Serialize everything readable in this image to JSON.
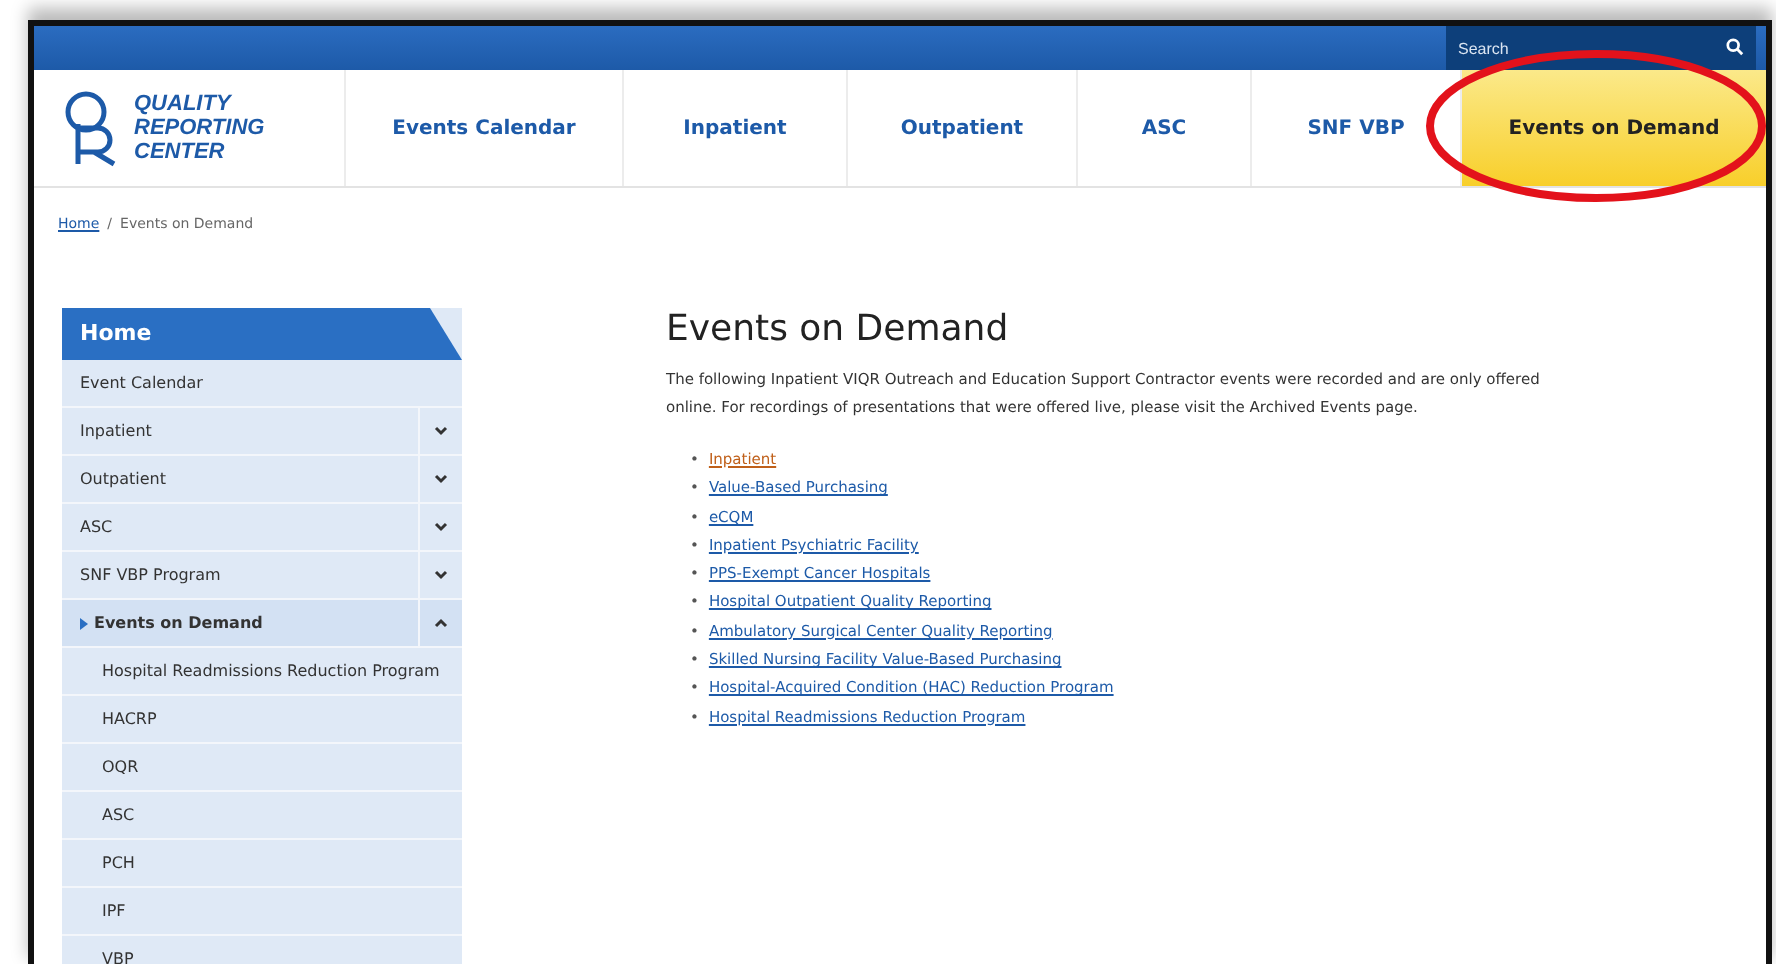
{
  "top_bar": {
    "search": {
      "placeholder": "Search"
    }
  },
  "logo": {
    "lines": [
      "QUALITY",
      "REPORTING",
      "CENTER"
    ]
  },
  "nav": [
    {
      "label": "Events Calendar",
      "selected": false,
      "circled": false
    },
    {
      "label": "Inpatient",
      "selected": false,
      "circled": false
    },
    {
      "label": "Outpatient",
      "selected": false,
      "circled": false
    },
    {
      "label": "ASC",
      "selected": false,
      "circled": false
    },
    {
      "label": "SNF VBP",
      "selected": false,
      "circled": false
    },
    {
      "label": "Events on Demand",
      "selected": true,
      "circled": true
    }
  ],
  "breadcrumb": {
    "link": "Home",
    "separator": "/",
    "current": "Events on Demand"
  },
  "sidebar": {
    "title": "Home",
    "items": [
      {
        "label": "Event Calendar",
        "selected": false
      },
      {
        "label": "Inpatient",
        "selected": false,
        "expanded": false
      },
      {
        "label": "Outpatient",
        "selected": false,
        "expanded": false
      },
      {
        "label": "ASC",
        "selected": false,
        "expanded": false
      },
      {
        "label": "SNF VBP Program",
        "selected": false,
        "expanded": false
      },
      {
        "label": "Events on Demand",
        "selected": true,
        "expanded": true,
        "children": [
          {
            "label": "Hospital Readmissions Reduction Program"
          },
          {
            "label": "HACRP"
          },
          {
            "label": "OQR"
          },
          {
            "label": "ASC"
          },
          {
            "label": "PCH"
          },
          {
            "label": "IPF"
          },
          {
            "label": "VBP"
          }
        ]
      }
    ]
  },
  "content": {
    "title": "Events on Demand",
    "intro": "The following Inpatient VIQR Outreach and Education Support Contractor events were recorded and are only offered online. For recordings of presentations that were offered live, please visit the Archived Events page.",
    "links": [
      {
        "marker": "•",
        "label": "Inpatient",
        "visited": true
      },
      {
        "marker": "•",
        "label": "Value-Based Purchasing",
        "visited": false
      },
      {
        "marker": "•",
        "label": "eCQM",
        "visited": false
      },
      {
        "marker": "•",
        "label": "Inpatient Psychiatric Facility",
        "visited": false
      },
      {
        "marker": "•",
        "label": "PPS-Exempt Cancer Hospitals",
        "visited": false
      },
      {
        "marker": "•",
        "label": "Hospital Outpatient Quality Reporting",
        "visited": false
      },
      {
        "marker": "•",
        "label": "Ambulatory Surgical Center Quality Reporting",
        "visited": false
      },
      {
        "marker": "•",
        "label": "Skilled Nursing Facility Value-Based Purchasing",
        "visited": false
      },
      {
        "marker": "•",
        "label": "Hospital-Acquired Condition (HAC) Reduction Program",
        "visited": false
      },
      {
        "marker": "•",
        "label": "Hospital Readmissions Reduction Program",
        "visited": false
      }
    ]
  }
}
